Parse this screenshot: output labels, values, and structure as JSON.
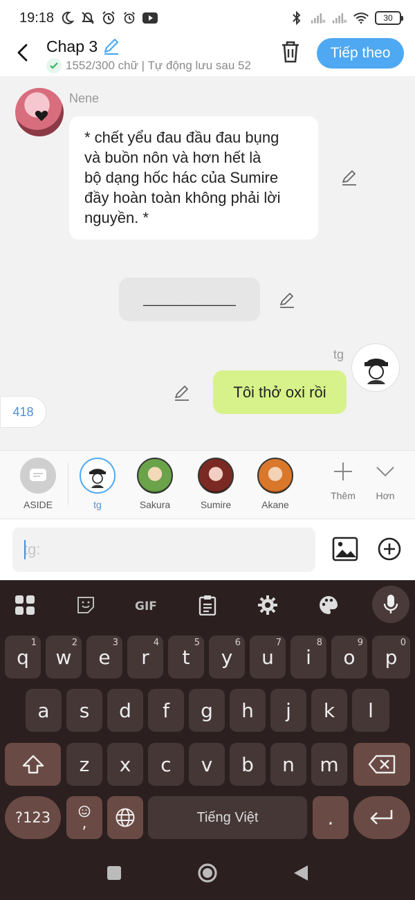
{
  "status_bar": {
    "time": "19:18",
    "battery": "30",
    "icons_left": [
      "moon-icon",
      "alarm-off-icon",
      "alarm-icon",
      "alarm-icon",
      "youtube-icon"
    ],
    "icons_right": [
      "bluetooth-icon",
      "signal-icon",
      "signal-icon",
      "wifi-icon",
      "battery-icon"
    ]
  },
  "header": {
    "title": "Chap 3",
    "save_status": "1552/300 chữ | Tự động lưu sau 52",
    "next_button": "Tiếp theo"
  },
  "messages": [
    {
      "sender": "Nene",
      "text": "* chết yểu đau đầu đau bụng và buồn nôn và hơn hết là bộ dạng hốc hác của Sumire đầy hoàn toàn không phải lời nguyền. *",
      "lines": [
        "* chết yểu đau đầu đau bụng",
        "và buồn nôn và hơn hết là",
        "bộ dạng hốc hác của Sumire",
        "đầy hoàn toàn không phải lời",
        "nguyền. *"
      ]
    },
    {
      "type": "divider",
      "text": "____________"
    },
    {
      "sender": "tg",
      "text": "Tôi thở oxi rồi"
    }
  ],
  "count_pill": "418",
  "characters": [
    {
      "name": "ASIDE",
      "selected": false
    },
    {
      "name": "tg",
      "selected": true
    },
    {
      "name": "Sakura",
      "selected": false
    },
    {
      "name": "Sumire",
      "selected": false
    },
    {
      "name": "Akane",
      "selected": false
    }
  ],
  "tools": {
    "add_label": "Thêm",
    "more_label": "Hơn"
  },
  "input": {
    "placeholder": "tg:"
  },
  "keyboard": {
    "row1": [
      {
        "key": "q",
        "hint": "1"
      },
      {
        "key": "w",
        "hint": "2"
      },
      {
        "key": "e",
        "hint": "3"
      },
      {
        "key": "r",
        "hint": "4"
      },
      {
        "key": "t",
        "hint": "5"
      },
      {
        "key": "y",
        "hint": "6"
      },
      {
        "key": "u",
        "hint": "7"
      },
      {
        "key": "i",
        "hint": "8"
      },
      {
        "key": "o",
        "hint": "9"
      },
      {
        "key": "p",
        "hint": "0"
      }
    ],
    "row2": [
      "a",
      "s",
      "d",
      "f",
      "g",
      "h",
      "j",
      "k",
      "l"
    ],
    "row3": [
      "z",
      "x",
      "c",
      "v",
      "b",
      "n",
      "m"
    ],
    "symbols_key": "?123",
    "emoji_comma": ",",
    "space_label": "Tiếng Việt",
    "period": "."
  },
  "colors": {
    "accent": "#4ea8f2",
    "my_bubble": "#d7f28a",
    "keyboard_bg": "#2b1f1f",
    "key_bg": "#463737",
    "mod_key_bg": "#6a4a44"
  }
}
